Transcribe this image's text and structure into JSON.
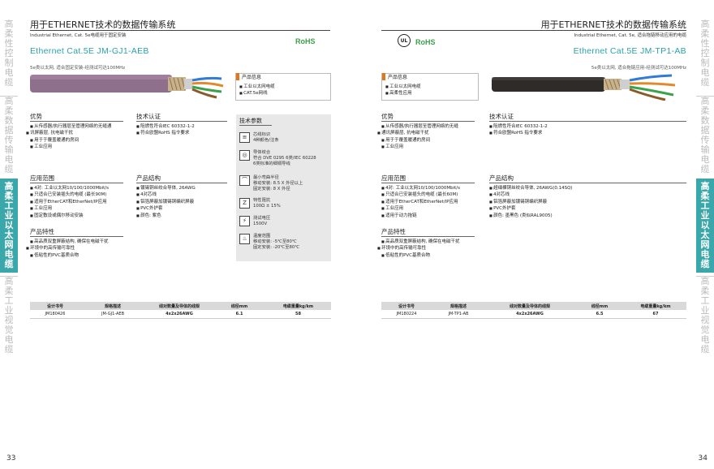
{
  "left": {
    "page_number": "33",
    "header_title": "用于ETHERNET技术的数据传输系统",
    "header_sub": "Industrial Ethernet, Cat. 5e电缆用于固定安装",
    "rohs": "RoHS",
    "product_name": "Ethernet Cat.5E JM-GJ1-AEB",
    "description": "5e类以太网, 适合固定安装-经测试可达100MHz",
    "info_title": "产品信息",
    "info_items": [
      "工业以太网电缆",
      "CAT.5e网线"
    ],
    "advantages_title": "优势",
    "advantages": [
      "从传感器/执行器层至管理网络的无缝通",
      "讯屏蔽层, 抗电磁干扰",
      "用于于覆盖暖通的房间",
      "工业应用"
    ],
    "cert_title": "技术认证",
    "cert_items": [
      "阻燃性符合IEC 60332-1-2",
      "符合欧盟RoHS 指令要求"
    ],
    "range_title": "应用范围",
    "range_items": [
      "4对: 工业以太网10/100/1000Mbit/s",
      "只适合已安装插头的电缆 (最长90M)",
      "适用于EtherCAT和EtherNet/IP应用",
      "工业应用",
      "固定敷设或偶尔移动安装"
    ],
    "structure_title": "产品结构",
    "structure_items": [
      "镀锡铜丝绞合导体, 26AWG",
      "4对芯线",
      "铝箔屏蔽加镀锡铜编织屏蔽",
      "PVC外护套",
      "颜色: 紫色"
    ],
    "features_title": "产品特性",
    "features_items": [
      "高品质双重屏蔽结构, 确保在电磁干扰",
      "环境中的高传输可靠性",
      "低粘性的PVC基质合物"
    ],
    "tech_title": "技术参数",
    "tech_rows": [
      {
        "icon": "core-marking-icon",
        "glyph": "≡",
        "lines": [
          "芯线标识",
          "4种颜色/注条"
        ]
      },
      {
        "icon": "conductor-icon",
        "glyph": "◎",
        "lines": [
          "导体绞合",
          "符合 DVE 0295 6类/IEC 60228",
          "6类标准的细铜导线"
        ]
      },
      {
        "icon": "bend-radius-icon",
        "glyph": "⌒",
        "lines": [
          "最小弯曲半径",
          "移动安装: 8.5 X 外径以上",
          "固定安装: 8 X 外径"
        ]
      },
      {
        "icon": "impedance-icon",
        "glyph": "Z",
        "lines": [
          "特性阻抗",
          "100Ω ± 15%"
        ]
      },
      {
        "icon": "voltage-icon",
        "glyph": "⚡",
        "lines": [
          "测试电压",
          "1500V"
        ]
      },
      {
        "icon": "temperature-icon",
        "glyph": "♨",
        "lines": [
          "温度范围",
          "移动安装: -5℃至80℃",
          "固定安装: -20℃至80℃"
        ]
      }
    ],
    "table_headers": [
      "设计书号",
      "规格描述",
      "线对数量及导体的线规",
      "线径mm",
      "电缆重量kg/km"
    ],
    "table_rows": [
      [
        "JM180426",
        "JM-GJ1-AEB",
        "4x2x26AWG",
        "6.1",
        "58"
      ]
    ],
    "side_tabs": [
      "高柔性控制电缆",
      "高柔数据传输电缆",
      "高柔工业以太网电缆",
      "高柔工业视觉电缆"
    ]
  },
  "right": {
    "page_number": "34",
    "header_title": "用于ETHERNET技术的数据传输系统",
    "header_sub": "Industrial Ethernet, Cat. 5e, 适合拖链移动应用的电缆",
    "rohs": "RoHS",
    "ul_mark": "UL",
    "product_name": "Ethernet Cat.5E JM-TP1-AB",
    "description": "5e类以太网, 适合拖链应用-经测试可达100MHz",
    "info_title": "产品信息",
    "info_items": [
      "工业以太网电缆",
      "高柔性应用"
    ],
    "advantages_title": "优势",
    "advantages": [
      "从传感器/执行器层至管理网络的无缝",
      "通讯屏蔽层, 抗电磁干扰",
      "用于于覆盖暖通的房间",
      "工业应用"
    ],
    "cert_title": "技术认证",
    "cert_items": [
      "阻燃性符合IEC 60332-1-2",
      "符合欧盟RoHS 指令要求"
    ],
    "range_title": "应用范围",
    "range_items": [
      "4对: 工业以太网10/100/1000Mbit/s",
      "只适合已安装插头的电缆 (最长60M)",
      "适用于EtherCAT和EtherNet/IP应用",
      "工业应用",
      "适用于动力拖链"
    ],
    "structure_title": "产品结构",
    "structure_items": [
      "超细裸铜丝绞合导体, 26AWG(0.14SQ)",
      "4对芯线",
      "铝箔屏蔽加镀锡铜编织屏蔽",
      "PVC外护套",
      "颜色: 墨黑色 (类似RAL9005)"
    ],
    "features_title": "产品特性",
    "features_items": [
      "高品质双重屏蔽结构, 确保在电磁干扰",
      "环境中的高传输可靠性",
      "低粘性的PVC基质合物"
    ],
    "table_headers": [
      "设计书号",
      "规格描述",
      "线对数量及导体的线规",
      "线径mm",
      "电缆重量kg/km"
    ],
    "table_rows": [
      [
        "JM180224",
        "JM-TP1-AB",
        "4x2x26AWG",
        "6.5",
        "67"
      ]
    ],
    "side_tabs": [
      "高柔性控制电缆",
      "高柔数据传输电缆",
      "高柔工业以太网电缆",
      "高柔工业视觉电缆"
    ]
  },
  "colors": {
    "accent": "#2aa2a8",
    "tab_active": "#3aa7aa",
    "rohs": "#3aa24a",
    "info_marker": "#e0781a",
    "left_jacket": "#8e6f8c",
    "right_jacket": "#2e2b29"
  }
}
